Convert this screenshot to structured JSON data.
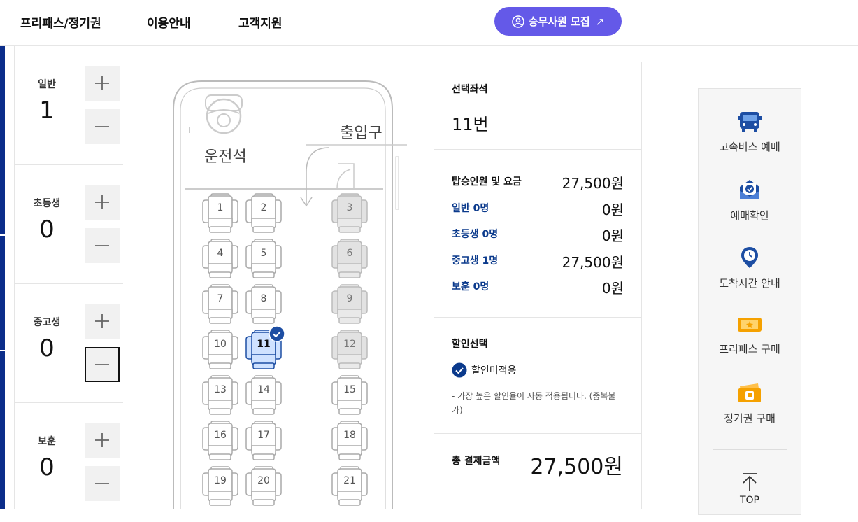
{
  "nav": {
    "items": [
      "프리패스/정기권",
      "이용안내",
      "고객지원"
    ],
    "recruit_label": "승무사원 모집",
    "recruit_arrow": "↗"
  },
  "passengers": [
    {
      "label": "일반",
      "count": "1"
    },
    {
      "label": "초등생",
      "count": "0"
    },
    {
      "label": "중고생",
      "count": "0"
    },
    {
      "label": "보훈",
      "count": "0"
    }
  ],
  "seatmap": {
    "driver_label": "운전석",
    "entrance_label": "출입구",
    "seats": [
      {
        "num": "1",
        "state": "available"
      },
      {
        "num": "2",
        "state": "available"
      },
      {
        "num": "3",
        "state": "disabled"
      },
      {
        "num": "4",
        "state": "available"
      },
      {
        "num": "5",
        "state": "available"
      },
      {
        "num": "6",
        "state": "disabled"
      },
      {
        "num": "7",
        "state": "available"
      },
      {
        "num": "8",
        "state": "available"
      },
      {
        "num": "9",
        "state": "disabled"
      },
      {
        "num": "10",
        "state": "available"
      },
      {
        "num": "11",
        "state": "selected"
      },
      {
        "num": "12",
        "state": "disabled"
      },
      {
        "num": "13",
        "state": "available"
      },
      {
        "num": "14",
        "state": "available"
      },
      {
        "num": "15",
        "state": "available"
      },
      {
        "num": "16",
        "state": "available"
      },
      {
        "num": "17",
        "state": "available"
      },
      {
        "num": "18",
        "state": "available"
      },
      {
        "num": "19",
        "state": "available"
      },
      {
        "num": "20",
        "state": "available"
      },
      {
        "num": "21",
        "state": "available"
      }
    ]
  },
  "summary": {
    "selected_title": "선택좌석",
    "selected_value": "11번",
    "fare_title": "탑승인원 및 요금",
    "fare_total": "27,500원",
    "fares": [
      {
        "label": "일반 0명",
        "value": "0원"
      },
      {
        "label": "초등생 0명",
        "value": "0원"
      },
      {
        "label": "중고생 1명",
        "value": "27,500원"
      },
      {
        "label": "보훈 0명",
        "value": "0원"
      }
    ],
    "discount_title": "할인선택",
    "discount_option": "할인미적용",
    "discount_note": "- 가장 높은 할인율이 자동 적용됩니다. (중복불가)",
    "total_label": "총 결제금액",
    "total_value": "27,500원"
  },
  "quickmenu": {
    "items": [
      "고속버스 예매",
      "예매확인",
      "도착시간 안내",
      "프리패스 구매",
      "정기권 구매"
    ],
    "top_label": "TOP"
  },
  "colors": {
    "accent": "#6459e8",
    "navy": "#0b2d8a",
    "fare_label": "#0b3a8c",
    "selected_seat": "#cfe2ff",
    "icon_blue": "#1d4ea3",
    "icon_orange": "#f5a100"
  }
}
